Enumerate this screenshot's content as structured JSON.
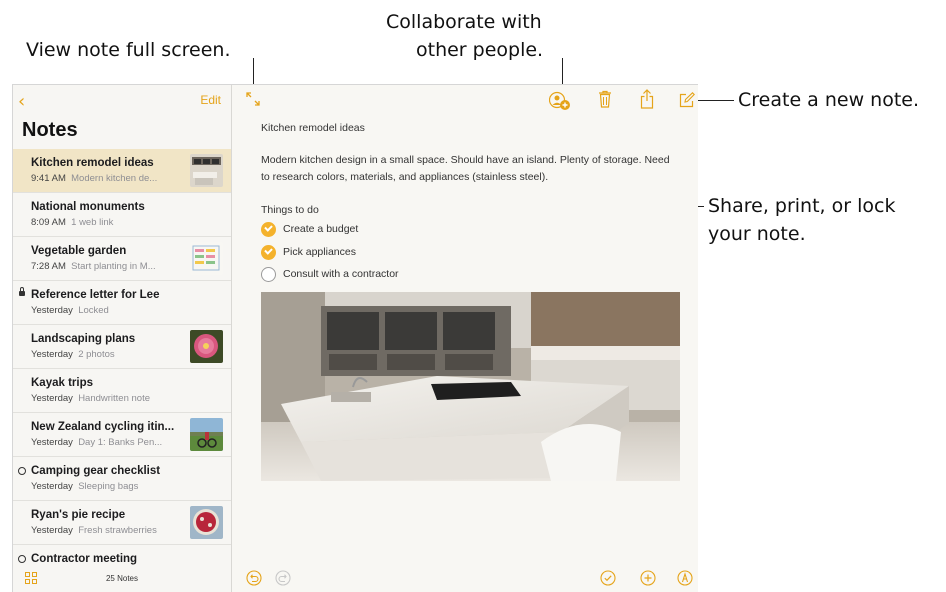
{
  "callouts": {
    "full_screen": "View note full screen.",
    "collaborate_line1": "Collaborate with",
    "collaborate_line2": "other people.",
    "new_note": "Create a new note.",
    "share_line1": "Share, print, or lock",
    "share_line2": "your note."
  },
  "sidebar": {
    "back_icon": "chevron-left-icon",
    "edit_label": "Edit",
    "title": "Notes",
    "notes": [
      {
        "title": "Kitchen remodel ideas",
        "time": "9:41 AM",
        "preview": "Modern kitchen de...",
        "selected": true,
        "thumb": "kitchen-photo"
      },
      {
        "title": "National monuments",
        "time": "8:09 AM",
        "preview": "1 web link"
      },
      {
        "title": "Vegetable garden",
        "time": "7:28 AM",
        "preview": "Start planting in M...",
        "thumb": "garden-sketch"
      },
      {
        "title": "Reference letter for Lee",
        "time": "Yesterday",
        "preview": "Locked",
        "icon": "lock-icon"
      },
      {
        "title": "Landscaping plans",
        "time": "Yesterday",
        "preview": "2 photos",
        "thumb": "flower-photo"
      },
      {
        "title": "Kayak trips",
        "time": "Yesterday",
        "preview": "Handwritten note"
      },
      {
        "title": "New Zealand cycling itin...",
        "time": "Yesterday",
        "preview": "Day 1: Banks Pen...",
        "thumb": "cycling-photo"
      },
      {
        "title": "Camping gear checklist",
        "time": "Yesterday",
        "preview": "Sleeping bags",
        "icon": "shared-icon"
      },
      {
        "title": "Ryan's pie recipe",
        "time": "Yesterday",
        "preview": "Fresh strawberries",
        "thumb": "pie-photo"
      },
      {
        "title": "Contractor meeting",
        "time": "",
        "preview": "",
        "icon": "shared-icon"
      }
    ],
    "note_count": "25 Notes"
  },
  "editor": {
    "title": "Kitchen remodel ideas",
    "body": "Modern kitchen design in a small space. Should have an island. Plenty of storage. Need to research colors, materials, and appliances (stainless steel).",
    "checklist_heading": "Things to do",
    "checklist": [
      {
        "label": "Create a budget",
        "done": true
      },
      {
        "label": "Pick appliances",
        "done": true
      },
      {
        "label": "Consult with a contractor",
        "done": false
      }
    ]
  },
  "colors": {
    "accent": "#e5a41a",
    "selected_row": "#f1e5c6"
  }
}
